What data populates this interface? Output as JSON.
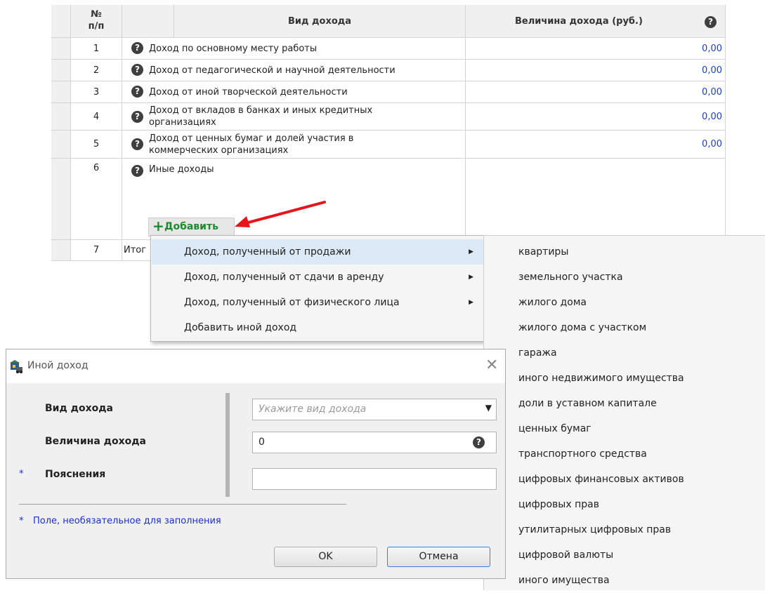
{
  "table": {
    "headers": {
      "num": "№\nп/п",
      "type": "Вид дохода",
      "amount": "Величина дохода (руб.)"
    },
    "rows": [
      {
        "num": "1",
        "text": "Доход по основному месту работы",
        "value": "0,00"
      },
      {
        "num": "2",
        "text": "Доход от педагогической и научной деятельности",
        "value": "0,00"
      },
      {
        "num": "3",
        "text": "Доход от иной творческой деятельности",
        "value": "0,00"
      },
      {
        "num": "4",
        "text": "Доход от вкладов в банках и иных кредитных организациях",
        "value": "0,00"
      },
      {
        "num": "5",
        "text": "Доход от ценных бумаг и долей участия в коммерческих организациях",
        "value": "0,00"
      },
      {
        "num": "6",
        "text": "Иные доходы",
        "value": ""
      },
      {
        "num": "7",
        "text": "Итог",
        "value": ""
      }
    ],
    "add_label": "Добавить",
    "add_icon": "plus-icon",
    "help_icon": "question-circle-icon"
  },
  "menu": {
    "items": [
      {
        "label": "Доход, полученный от продажи",
        "has_submenu": true
      },
      {
        "label": "Доход, полученный от сдачи в аренду",
        "has_submenu": true
      },
      {
        "label": "Доход, полученный от физического лица",
        "has_submenu": true
      },
      {
        "label": "Добавить иной доход",
        "has_submenu": false
      }
    ],
    "submenu_items": [
      "квартиры",
      "земельного участка",
      "жилого дома",
      "жилого дома с участком",
      "гаража",
      "иного недвижимого имущества",
      "доли в уставном капитале",
      "ценных бумаг",
      "транспортного средства",
      "цифровых финансовых активов",
      "цифровых прав",
      "утилитарных цифровых прав",
      "цифровой валюты",
      "иного имущества"
    ]
  },
  "dialog": {
    "title": "Иной доход",
    "fields": {
      "type_label": "Вид дохода",
      "type_placeholder": "Укажите вид дохода",
      "amount_label": "Величина дохода",
      "amount_value": "0",
      "notes_label": "Пояснения",
      "notes_value": ""
    },
    "required_mark": "*",
    "footnote": "Поле, необязательное для заполнения",
    "ok_label": "OK",
    "cancel_label": "Отмена"
  },
  "colors": {
    "link_blue": "#1a3fcf",
    "add_green": "#1e8a2e",
    "arrow_red": "#e8141b",
    "menu_highlight": "#dce9f7",
    "footnote_blue": "#1a2fcf"
  }
}
